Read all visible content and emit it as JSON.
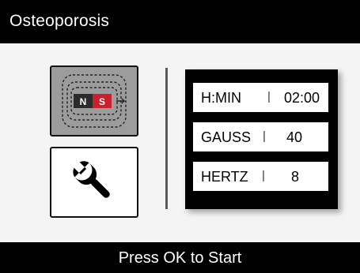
{
  "header": {
    "title": "Osteoporosis"
  },
  "buttons": {
    "magnet": {
      "icon": "magnet-field-icon",
      "north": "N",
      "south": "S",
      "background": "#9c9c9c"
    },
    "settings": {
      "icon": "wrench-icon"
    }
  },
  "params": [
    {
      "label": "H:MIN",
      "separator": "|",
      "value": "02:00"
    },
    {
      "label": "GAUSS",
      "separator": "|",
      "value": "40"
    },
    {
      "label": "HERTZ",
      "separator": "|",
      "value": "8"
    }
  ],
  "footer": {
    "prompt": "Press OK to Start"
  },
  "colors": {
    "bar": "#000000",
    "background": "#f4f4f4",
    "north_pole": "#2b2b2b",
    "south_pole": "#c8202c"
  }
}
